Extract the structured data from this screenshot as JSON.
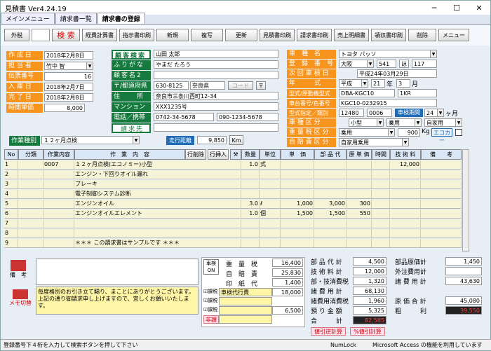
{
  "window": {
    "title": "見積書 Ver4.24.19"
  },
  "tabs": [
    {
      "label": "メインメニュー"
    },
    {
      "label": "請求書一覧"
    },
    {
      "label": "請求書の登録"
    }
  ],
  "toolbar": {
    "gaizei": "外税",
    "search": "検 索",
    "keihi": "経費計算書",
    "shiji": "指示書印刷",
    "new": "新規",
    "copy": "複写",
    "update": "更新",
    "mitsu": "見積書印刷",
    "seikyu": "請求書印刷",
    "uriage": "売上明細書",
    "ryoshu": "領収書印刷",
    "delete": "削除",
    "menu": "メニュー"
  },
  "left": {
    "labels": [
      "作 成 日",
      "担 当 者",
      "伝票番号",
      "入 庫 日",
      "完 了 日",
      "時間単価"
    ],
    "values": [
      "2018年2月8日",
      "竹中 智",
      "16",
      "2018年2月7日",
      "2018年2月8日",
      "8,000"
    ]
  },
  "customer": {
    "btn": "顧客検索",
    "labels": [
      "ふりがな",
      "顧客名2",
      "〒/都道府県",
      "住　　所",
      "マンション名",
      "電話／携帯"
    ],
    "name": "山田 太郎",
    "furigana": "やまだ たろう",
    "zip": "630-8125",
    "pref": "奈良県",
    "addr": "奈良市三条川西町12-34",
    "mansion": "XXX1235号",
    "tel": "0742-34-5678",
    "mobile": "090-1234-5678",
    "code": "コード",
    "seikyu": "請求先"
  },
  "car": {
    "labels": [
      "車　種　名",
      "登　録　番　号",
      "次 回 車 検 日",
      "年　　　式",
      "型式/原動機型式",
      "車台番号/色番号",
      "型式指定／類別",
      "車 種 区 分",
      "重 量 税 区 分",
      "自 賠 責 区 分"
    ],
    "shamei": "トヨタ パッソ",
    "area": "大阪",
    "num1": "541",
    "kana": "ほ",
    "num2": "117",
    "shaken": "平成24年03月29日",
    "era": "平成",
    "year": "21",
    "nen": "年",
    "month": "3",
    "tsuki": "月",
    "katashiki": "DBA-KGC10",
    "engine": "1KR",
    "chassis": "KGC10-0232915",
    "katashitei": "12480",
    "ruibetsu": "0006",
    "shaken_kikan": "車検期間",
    "kikan": "24",
    "kagetsu": "ヶ月",
    "kubun1": "小型",
    "kubun2": "乗用",
    "kubun3": "自家用",
    "juryo": "乗用",
    "weight": "900",
    "kg": "Kg",
    "eco": "エコカー",
    "jibai": "自家用乗用"
  },
  "worktype": {
    "label": "作業種別",
    "value": "１２ヶ月点検",
    "kyori_label": "走行距離",
    "kyori": "9,850",
    "km": "Km"
  },
  "grid": {
    "headers": [
      "No",
      "分類",
      "作業内容",
      "作　業　内　容",
      "行削除",
      "行挿入",
      "数量",
      "単位",
      "単　価",
      "部 品 代",
      "原 単 価",
      "時間",
      "技 術 料",
      "備　　考"
    ],
    "rows": [
      {
        "no": "1",
        "code": "0007",
        "item": "１２ヶ月点検(エコノミー)小型",
        "qty": "1.0",
        "unit": "式",
        "price": "",
        "parts": "",
        "cost": "",
        "time": "",
        "tech": "12,000"
      },
      {
        "no": "2",
        "code": "",
        "item": "エンジン・下回りオイル漏れ",
        "qty": "",
        "unit": "",
        "price": "",
        "parts": "",
        "cost": "",
        "time": "",
        "tech": ""
      },
      {
        "no": "3",
        "code": "",
        "item": "ブレーキ",
        "qty": "",
        "unit": "",
        "price": "",
        "parts": "",
        "cost": "",
        "time": "",
        "tech": ""
      },
      {
        "no": "4",
        "code": "",
        "item": "電子制御システム診断",
        "qty": "",
        "unit": "",
        "price": "",
        "parts": "",
        "cost": "",
        "time": "",
        "tech": ""
      },
      {
        "no": "5",
        "code": "",
        "item": "エンジンオイル",
        "qty": "3.0",
        "unit": "ℓ",
        "price": "1,000",
        "parts": "3,000",
        "cost": "300",
        "time": "",
        "tech": ""
      },
      {
        "no": "6",
        "code": "",
        "item": "エンジンオイルエレメント",
        "qty": "1.0",
        "unit": "個",
        "price": "1,500",
        "parts": "1,500",
        "cost": "550",
        "time": "",
        "tech": ""
      },
      {
        "no": "7",
        "code": "",
        "item": "",
        "qty": "",
        "unit": "",
        "price": "",
        "parts": "",
        "cost": "",
        "time": "",
        "tech": ""
      },
      {
        "no": "8",
        "code": "",
        "item": "",
        "qty": "",
        "unit": "",
        "price": "",
        "parts": "",
        "cost": "",
        "time": "",
        "tech": ""
      },
      {
        "no": "9",
        "code": "",
        "item": "＊＊＊ この請求書はサンプルです ＊＊＊",
        "qty": "",
        "unit": "",
        "price": "",
        "parts": "",
        "cost": "",
        "time": "",
        "tech": ""
      }
    ]
  },
  "bottom": {
    "biko": "備　考",
    "memo_btn": "メモ切替",
    "message": "毎度格別のお引き立て賜り、まことにありがとうございます。上記の通り御請求申し上げますので、宜しくお願いいたします。",
    "shaken_on": "車検ON",
    "juryo": "重　量　税",
    "juryo_v": "16,400",
    "jibai": "自　賠　責",
    "jibai_v": "25,830",
    "inshi": "印　紙　代",
    "inshi_v": "1,400",
    "kazei": "課税",
    "hikazei": "非課",
    "daikou": "車検代行費",
    "daikou_v": "18,000",
    "fee2_v": "6,500",
    "sum_labels": [
      "部 品 代 計",
      "技 術 料 計",
      "部・技消費税",
      "諸 費 用 計",
      "諸費用消費税",
      "預 り 金 額",
      "合　　　計"
    ],
    "sum_values": [
      "4,500",
      "12,000",
      "1,320",
      "68,130",
      "1,960",
      "5,325",
      "82,585"
    ],
    "right_labels": [
      "部品原価計",
      "外注費用計",
      "諸 費 用 計",
      "原 価 合 計",
      "粗　　　利"
    ],
    "right_values": [
      "1,450",
      "",
      "43,630",
      "45,080",
      "39,550"
    ],
    "btn1": "値引逆計算",
    "btn2": "%値引計算"
  },
  "status": {
    "text": "登録番号下４桁を入力して検索ボタンを押して下さい",
    "numlock": "NumLock",
    "access": "Microsoft Access の機能を利用しています"
  }
}
